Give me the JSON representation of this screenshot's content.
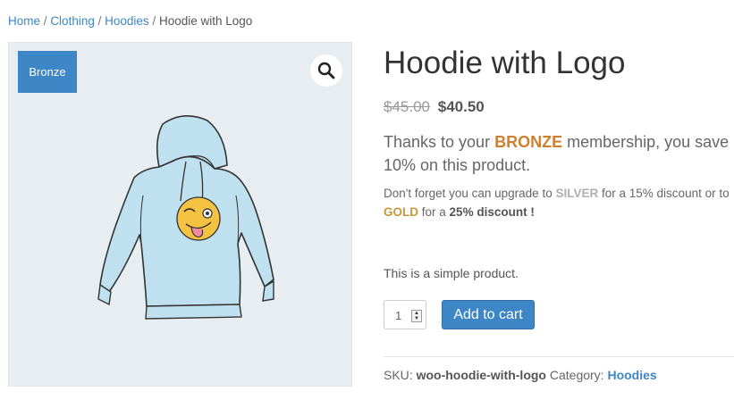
{
  "breadcrumb": {
    "home": "Home",
    "clothing": "Clothing",
    "hoodies": "Hoodies",
    "current": "Hoodie with Logo",
    "separator": "/"
  },
  "gallery": {
    "badge": "Bronze",
    "zoom_icon": "magnifier-icon"
  },
  "product": {
    "title": "Hoodie with Logo",
    "regular_price": "$45.00",
    "sale_price": "$40.50",
    "membership": {
      "prefix": "Thanks to your",
      "level": "BRONZE",
      "suffix": "membership, you save 10% on this product."
    },
    "upgrade": {
      "part1": "Don't forget you can upgrade to",
      "silver": "SILVER",
      "part2": "for a 15% discount or to",
      "gold": "GOLD",
      "part3": "for a",
      "gold_discount": "25% discount !"
    },
    "short_description": "This is a simple product.",
    "quantity": "1",
    "add_to_cart": "Add to cart",
    "meta": {
      "sku_label": "SKU:",
      "sku": "woo-hoodie-with-logo",
      "category_label": "Category:",
      "category": "Hoodies"
    }
  },
  "colors": {
    "link": "#3d87c6",
    "bronze": "#cd7f32",
    "silver": "#b0b0b0",
    "gold": "#c49a3c",
    "button": "#3d87c6"
  }
}
